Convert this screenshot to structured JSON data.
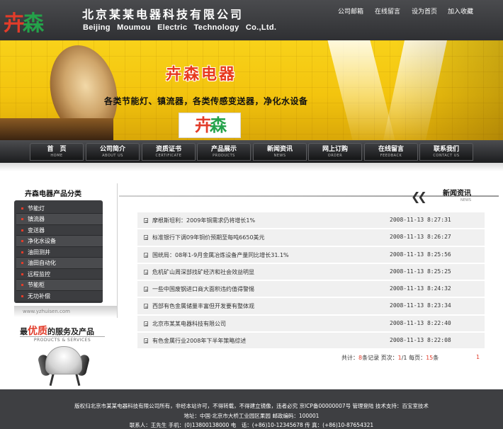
{
  "header": {
    "logo_glyphs": [
      "卉",
      "森"
    ],
    "company_cn": "北京某某电器科技有限公司",
    "company_en": "Beijing Moumou Electric Technology Co.,Ltd.",
    "top_links": [
      "公司邮箱",
      "在线留言",
      "设为首页",
      "加入收藏"
    ]
  },
  "banner": {
    "brand": "卉森电器",
    "slogan": "各类节能灯、镇流器，各类传感变送器，净化水设备",
    "logo_glyphs": [
      "卉",
      "森"
    ]
  },
  "nav": [
    {
      "cn": "首　页",
      "en": "HOME"
    },
    {
      "cn": "公司简介",
      "en": "ABOUT US"
    },
    {
      "cn": "资质证书",
      "en": "CERTIFICATE"
    },
    {
      "cn": "产品展示",
      "en": "PRODUCTS"
    },
    {
      "cn": "新闻资讯",
      "en": "NEWS"
    },
    {
      "cn": "网上订购",
      "en": "ORDER"
    },
    {
      "cn": "在线留言",
      "en": "FEEDBACK"
    },
    {
      "cn": "联系我们",
      "en": "CONTACT US"
    }
  ],
  "sidebar": {
    "title": "卉森电器产品分类",
    "categories": [
      "节能灯",
      "镇流器",
      "变送器",
      "净化水设备",
      "油田测井",
      "油田自动化",
      "远程监控",
      "节能柜",
      "无功补偿"
    ],
    "site_url": "www.yzhuisen.com",
    "service_title_prefix": "最",
    "service_title_highlight": "优质",
    "service_title_suffix": "的服务及产品",
    "service_sub": "PRODUCTS & SERVICES"
  },
  "news": {
    "title": "新闻资讯",
    "title_en": "NEWS",
    "items": [
      {
        "title": "摩根斯坦利：2009年铜需求仍将增长1%",
        "date": "2008-11-13 8:27:31"
      },
      {
        "title": "标准银行下调09年铜价预期至每吨6650美元",
        "date": "2008-11-13 8:26:27"
      },
      {
        "title": "国统局：08年1-9月金属冶炼设备产量同比增长31.1%",
        "date": "2008-11-13 8:25:56"
      },
      {
        "title": "危机矿山周深部找矿经济和社会效益明显",
        "date": "2008-11-13 8:25:25"
      },
      {
        "title": "一些中国废钢进口商大面积违约值得警惕",
        "date": "2008-11-13 8:24:32"
      },
      {
        "title": "西部有色金属储量丰富但开发要有整体观",
        "date": "2008-11-13 8:23:34"
      },
      {
        "title": "北京市某某电器科技有限公司",
        "date": "2008-11-13 8:22:40"
      },
      {
        "title": "有色金属行业2008年下半年策略综述",
        "date": "2008-11-13 8:22:08"
      }
    ],
    "pager": {
      "total_label": "共计：",
      "total": "8",
      "total_unit": "条记录",
      "page_label": "页次：",
      "page": "1",
      "page_sep": "/1",
      "per_page_label": "每页：",
      "per_page": "15",
      "per_page_unit": "条",
      "page_link": "1"
    }
  },
  "footer": {
    "line1": "版权归北京市某某电器科技有限公司所有，非经本站许可，不得转载，不得建立镜像，违者必究 京ICP备00000007号 管理登陆   技术支持：百宝室技术",
    "line2": "地址：中国·北京市大桥工业园区果园      邮政编码：100001",
    "line3": "联系人：王先生   手机：(0)13800138000   电　话：(+86)10-12345678   传 真：(+86)10-87654321"
  },
  "colors": {
    "header_bg": "#3a3b3e",
    "banner_yellow": "#f3c40e",
    "accent_red": "#e23c2a",
    "footer_bg": "#3e3f42"
  }
}
